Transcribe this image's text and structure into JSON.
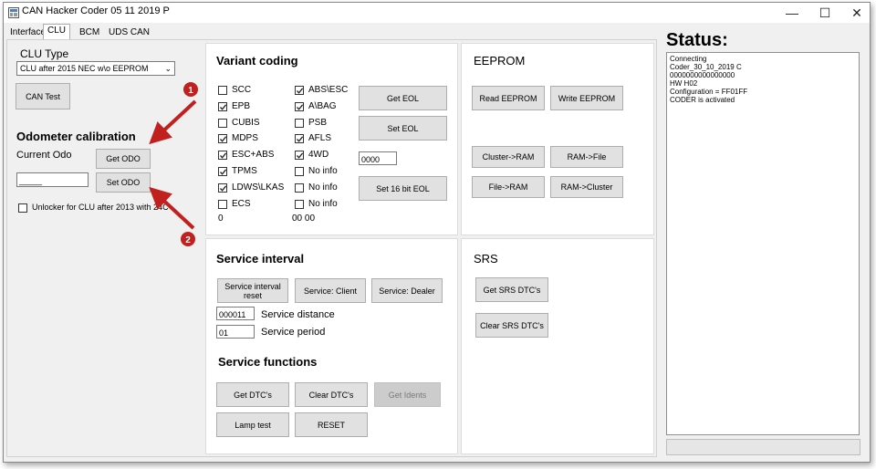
{
  "window": {
    "title": "CAN Hacker Coder 05 11 2019 P",
    "minimize": "—",
    "maximize": "☐",
    "close": "✕"
  },
  "tabs": [
    "Interface",
    "CLU",
    "BCM",
    "UDS CAN"
  ],
  "active_tab": "CLU",
  "left": {
    "clu_type_label": "CLU Type",
    "clu_type_value": "CLU after 2015 NEC w\\o EEPROM",
    "can_test": "CAN Test",
    "odometer_title": "Odometer calibration",
    "current_odo_label": "Current Odo",
    "get_odo": "Get ODO",
    "odo_value": "_____",
    "set_odo": "Set ODO",
    "unlocker_label": "Unlocker for CLU after 2013 with 24C"
  },
  "variant": {
    "title": "Variant coding",
    "col1": [
      {
        "label": "SCC",
        "checked": false
      },
      {
        "label": "EPB",
        "checked": true
      },
      {
        "label": "CUBIS",
        "checked": false
      },
      {
        "label": "MDPS",
        "checked": true
      },
      {
        "label": "ESC+ABS",
        "checked": true
      },
      {
        "label": "TPMS",
        "checked": true
      },
      {
        "label": "LDWS\\LKAS",
        "checked": true
      },
      {
        "label": "ECS",
        "checked": false
      }
    ],
    "col2": [
      {
        "label": "ABS\\ESC",
        "checked": true
      },
      {
        "label": "A\\BAG",
        "checked": true
      },
      {
        "label": "PSB",
        "checked": false
      },
      {
        "label": "AFLS",
        "checked": true
      },
      {
        "label": "4WD",
        "checked": true
      },
      {
        "label": "No info",
        "checked": false
      },
      {
        "label": "No info",
        "checked": false
      },
      {
        "label": "No info",
        "checked": false
      }
    ],
    "bottom_left": "0",
    "bottom_mid": "00  00",
    "get_eol": "Get EOL",
    "set_eol": "Set EOL",
    "eol_value": "0000",
    "set_16bit_eol": "Set 16 bit  EOL"
  },
  "eeprom": {
    "title": "EEPROM",
    "read": "Read EEPROM",
    "write": "Write EEPROM",
    "cluster_ram": "Cluster->RAM",
    "ram_file": "RAM->File",
    "file_ram": "File->RAM",
    "ram_cluster": "RAM->Cluster"
  },
  "service": {
    "title": "Service interval",
    "reset": "Service interval reset",
    "client": "Service: Client",
    "dealer": "Service: Dealer",
    "distance_value": "000011",
    "distance_label": "Service distance",
    "period_value": "01",
    "period_label": "Service period",
    "functions_title": "Service functions",
    "get_dtcs": "Get DTC's",
    "clear_dtcs": "Clear DTC's",
    "get_idents": "Get Idents",
    "lamp_test": "Lamp test",
    "reset_btn": "RESET"
  },
  "srs": {
    "title": "SRS",
    "get": "Get SRS DTC's",
    "clear": "Clear SRS DTC's"
  },
  "status": {
    "title": "Status:",
    "lines": [
      "Connecting",
      " Coder_30_10_2019 C",
      " 0000000000000000",
      "HW H02",
      "Configuration = FF01FF",
      "CODER is activated"
    ]
  },
  "annotations": {
    "marker1": "1",
    "marker2": "2",
    "color": "#c0201e"
  }
}
